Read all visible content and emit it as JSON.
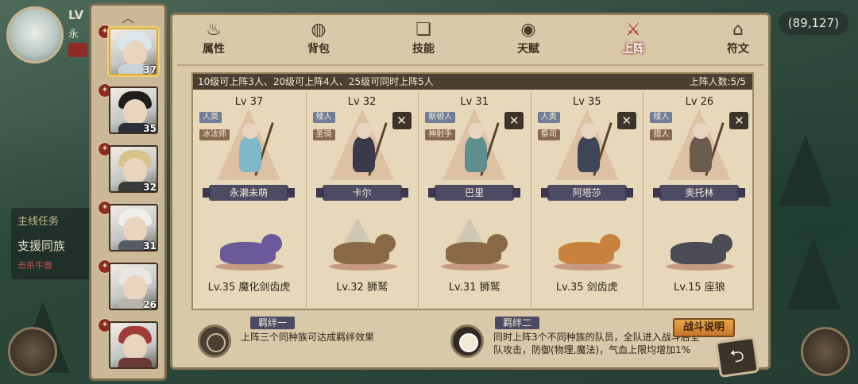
{
  "hud": {
    "level_prefix": "LV",
    "name_fragment": "永",
    "coords": "(89,127)"
  },
  "quest": {
    "title": "主线任务",
    "name": "支援同族",
    "sub": "击杀牛兽"
  },
  "sidebar": {
    "characters": [
      {
        "level": "37",
        "selected": true,
        "hair": "#d9e6ec",
        "body_color": "#c7d3d8"
      },
      {
        "level": "35",
        "selected": false,
        "hair": "#1f1d1c",
        "body_color": "#2a2f3a"
      },
      {
        "level": "32",
        "selected": false,
        "hair": "#d8c38a",
        "body_color": "#3b3a3a"
      },
      {
        "level": "31",
        "selected": false,
        "hair": "#eeeeec",
        "body_color": "#555b66"
      },
      {
        "level": "26",
        "selected": false,
        "hair": "#e9e6e1",
        "body_color": "#b8b3ab"
      },
      {
        "level": "",
        "selected": false,
        "hair": "#a13b36",
        "body_color": "#6c3a36"
      }
    ]
  },
  "tabs": [
    {
      "label": "属性",
      "icon": "flame-icon",
      "glyph": "♨",
      "active": false
    },
    {
      "label": "背包",
      "icon": "bag-icon",
      "glyph": "◍",
      "active": false
    },
    {
      "label": "技能",
      "icon": "book-icon",
      "glyph": "❏",
      "active": false
    },
    {
      "label": "天赋",
      "icon": "eye-icon",
      "glyph": "◉",
      "active": false
    },
    {
      "label": "上阵",
      "icon": "crossed-swords-icon",
      "glyph": "⚔",
      "active": true
    },
    {
      "label": "符文",
      "icon": "rune-icon",
      "glyph": "⌂",
      "active": false
    }
  ],
  "lineup": {
    "rule_text": "10级可上阵3人、20级可上阵4人、25级可同时上阵5人",
    "count_text": "上阵人数:5/5",
    "units": [
      {
        "level": "Lv 37",
        "race": "人类",
        "cls": "冰法师",
        "name": "永濑未萌",
        "removable": false,
        "hero_color": "#7fb7c9",
        "pet_label": "Lv.35 魔化剑齿虎",
        "pet_color": "#6a5a9a",
        "pet_wing": false
      },
      {
        "level": "Lv 32",
        "race": "矮人",
        "cls": "圣骑",
        "name": "卡尔",
        "removable": true,
        "hero_color": "#3a3a4a",
        "pet_label": "Lv.32 狮鹫",
        "pet_color": "#8a6a46",
        "pet_wing": true
      },
      {
        "level": "Lv 31",
        "race": "斯顿人",
        "cls": "神射手",
        "name": "巴里",
        "removable": true,
        "hero_color": "#5f8f8c",
        "pet_label": "Lv.31 狮鹫",
        "pet_color": "#8a6a46",
        "pet_wing": true
      },
      {
        "level": "Lv 35",
        "race": "人类",
        "cls": "祭司",
        "name": "阿塔莎",
        "removable": true,
        "hero_color": "#3e4656",
        "pet_label": "Lv.35 剑齿虎",
        "pet_color": "#c8823e",
        "pet_wing": false
      },
      {
        "level": "Lv 26",
        "race": "矮人",
        "cls": "猎人",
        "name": "奥托林",
        "removable": true,
        "hero_color": "#6b5c4e",
        "pet_label": "Lv.15 座狼",
        "pet_color": "#4b4b55",
        "pet_wing": false
      }
    ]
  },
  "bonds": [
    {
      "title": "羁绊一",
      "desc": "上阵三个同种族可达成羁绊效果",
      "active": false
    },
    {
      "title": "羁绊二",
      "desc": "同时上阵3个不同种族的队员，全队进入战斗后全队攻击，防御(物理,魔法)，气血上限均增加1%",
      "active": true
    }
  ],
  "buttons": {
    "battle_info": "战斗说明",
    "back": "⮌",
    "remove": "✕",
    "scroll_up": "︿",
    "scroll_down": "﹀"
  }
}
